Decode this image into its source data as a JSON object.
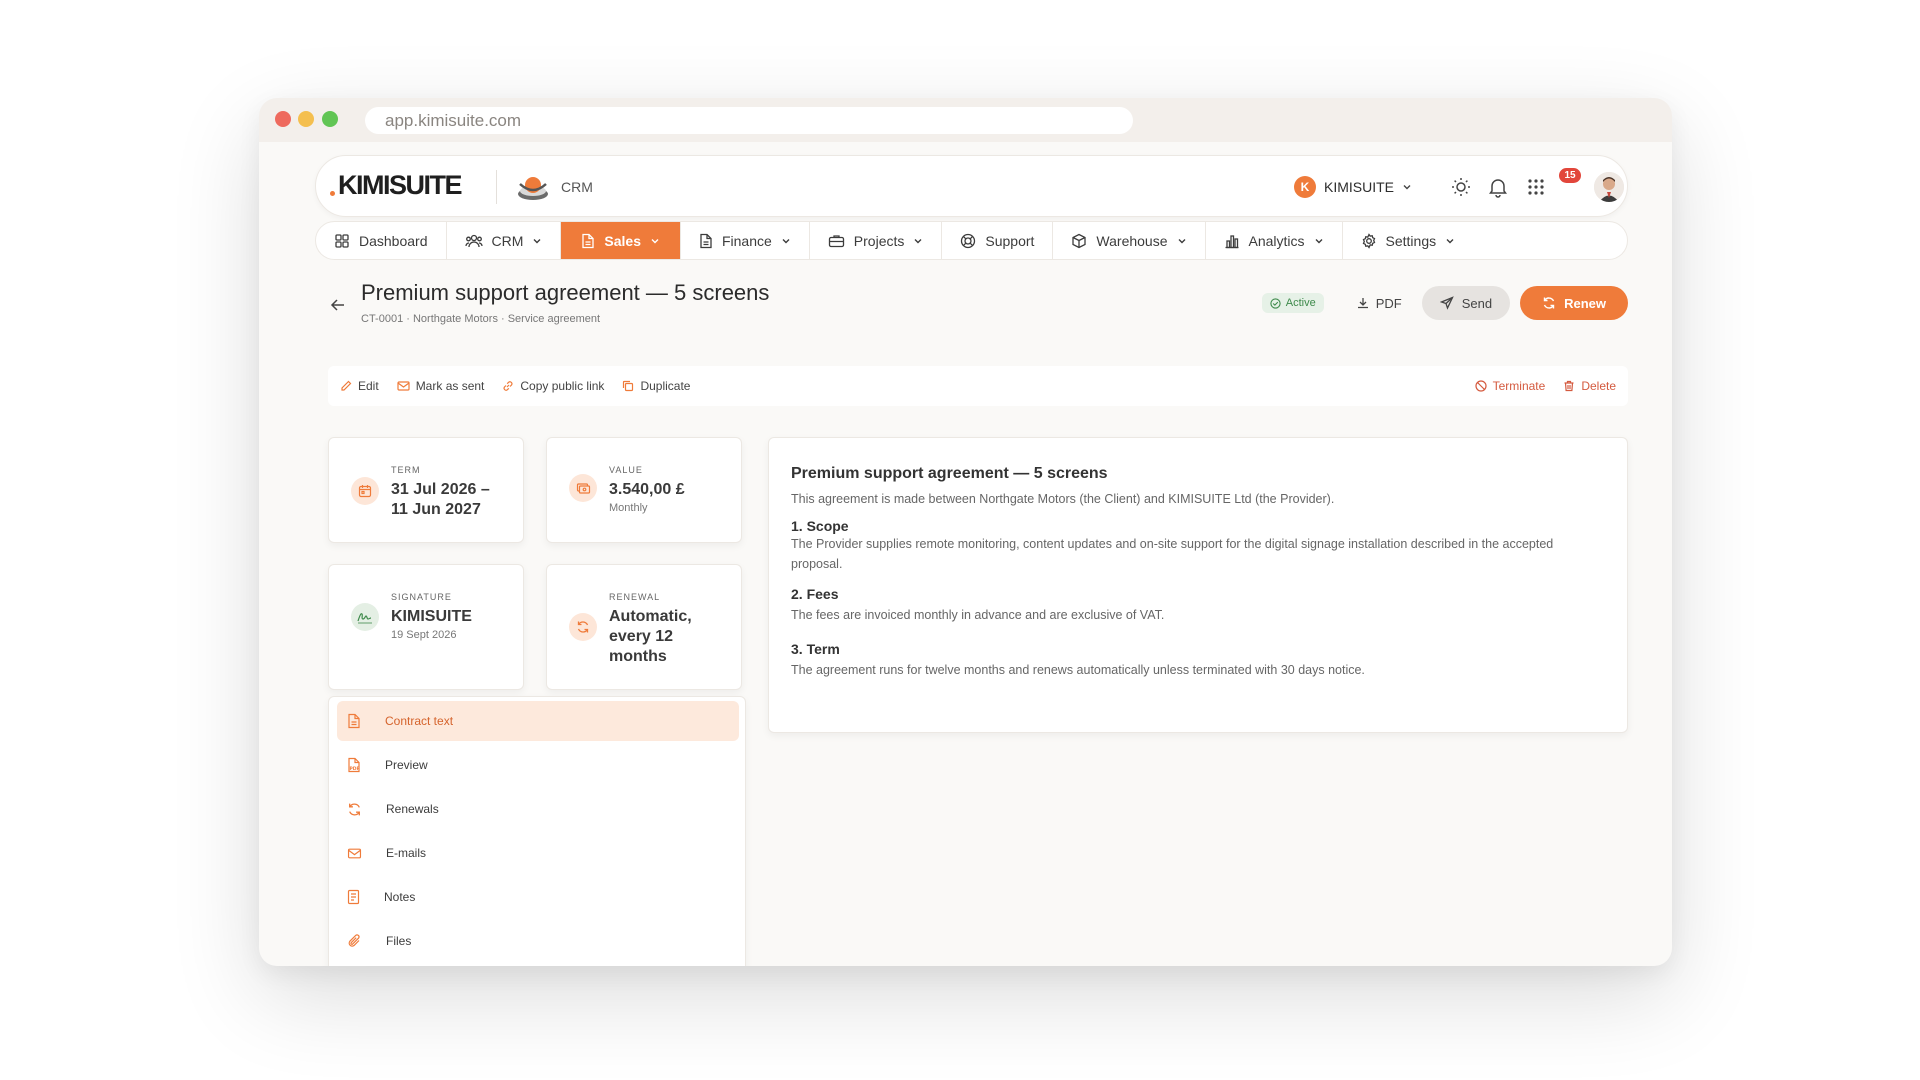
{
  "browser": {
    "url": "app.kimisuite.com"
  },
  "header": {
    "logo_text": "KIMISUITE",
    "app_name": "CRM",
    "org_initial": "K",
    "org_name": "KIMISUITE",
    "notification_count": "15",
    "accent_color": "#ef7b3a"
  },
  "nav": {
    "items": [
      {
        "label": "Dashboard",
        "icon": "dashboard-icon"
      },
      {
        "label": "CRM",
        "icon": "users-icon"
      },
      {
        "label": "Sales",
        "icon": "document-icon",
        "active": true
      },
      {
        "label": "Finance",
        "icon": "document-icon"
      },
      {
        "label": "Projects",
        "icon": "briefcase-icon"
      },
      {
        "label": "Support",
        "icon": "lifebuoy-icon"
      },
      {
        "label": "Warehouse",
        "icon": "box-icon"
      },
      {
        "label": "Analytics",
        "icon": "bar-chart-icon"
      },
      {
        "label": "Settings",
        "icon": "gear-icon"
      }
    ]
  },
  "page": {
    "title": "Premium support agreement — 5 screens",
    "subtitle": "CT-0001 · Northgate Motors · Service agreement",
    "status": "Active",
    "status_color": "#3e8a4b",
    "pdf_label": "PDF",
    "send_label": "Send",
    "renew_label": "Renew"
  },
  "toolbar": {
    "edit": "Edit",
    "mark_sent": "Mark as sent",
    "copy_link": "Copy public link",
    "duplicate": "Duplicate",
    "terminate": "Terminate",
    "delete": "Delete"
  },
  "kpis": {
    "term": {
      "label": "TERM",
      "value_line1": "31 Jul 2026 –",
      "value_line2": "11 Jun 2027"
    },
    "value": {
      "label": "VALUE",
      "value": "3.540,00 £",
      "sub": "Monthly"
    },
    "signature": {
      "label": "SIGNATURE",
      "value": "KIMISUITE",
      "sub": "19 Sept 2026"
    },
    "renewal": {
      "label": "RENEWAL",
      "value_line1": "Automatic,",
      "value_line2": "every 12",
      "value_line3": "months"
    }
  },
  "side_menu": {
    "items": [
      {
        "label": "Contract text",
        "icon": "document-icon",
        "active": true
      },
      {
        "label": "Preview",
        "icon": "pdf-icon"
      },
      {
        "label": "Renewals",
        "icon": "refresh-icon"
      },
      {
        "label": "E-mails",
        "icon": "mail-icon"
      },
      {
        "label": "Notes",
        "icon": "notes-icon"
      },
      {
        "label": "Files",
        "icon": "paperclip-icon"
      }
    ]
  },
  "contract": {
    "title": "Premium support agreement — 5 screens",
    "intro": "This agreement is made between Northgate Motors (the Client) and KIMISUITE Ltd (the Provider).",
    "sections": [
      {
        "heading": "1. Scope",
        "body": "The Provider supplies remote monitoring, content updates and on-site support for the digital signage installation described in the accepted proposal."
      },
      {
        "heading": "2. Fees",
        "body": "The fees are invoiced monthly in advance and are exclusive of VAT."
      },
      {
        "heading": "3. Term",
        "body": "The agreement runs for twelve months and renews automatically unless terminated with 30 days notice."
      }
    ]
  }
}
